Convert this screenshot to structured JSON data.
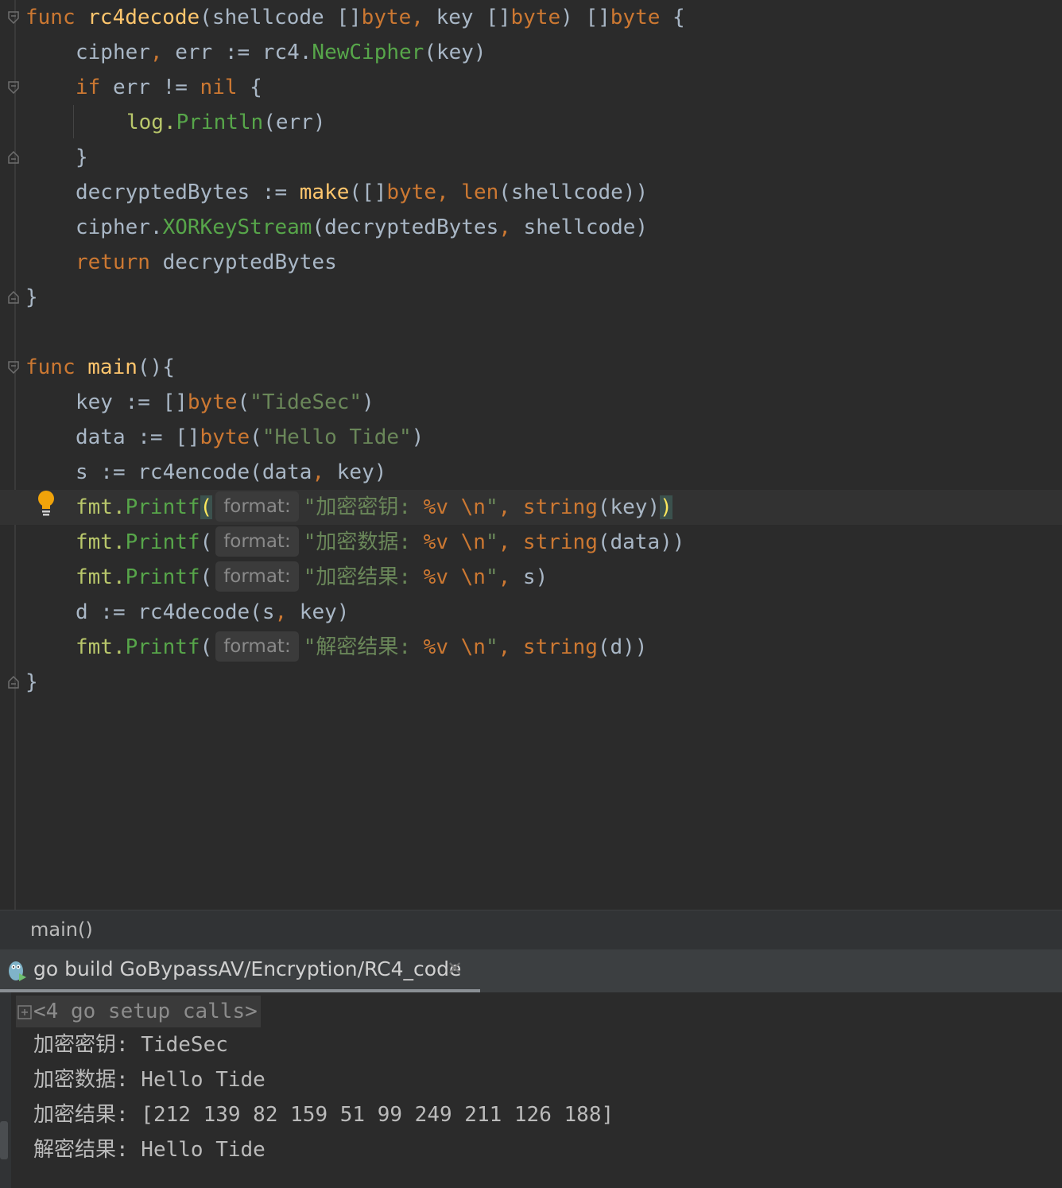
{
  "editor": {
    "lines": [
      [
        "func ",
        "rc4decode",
        "(shellcode []",
        "byte",
        ", ",
        "key []",
        "byte",
        ") []",
        "byte",
        " {"
      ],
      [
        "cipher",
        ", ",
        "err := rc4.",
        "NewCipher",
        "(key)"
      ],
      [
        "if",
        " err != ",
        "nil",
        " {"
      ],
      [
        "log.",
        "Println",
        "(err)"
      ],
      [
        "}"
      ],
      [
        "decryptedBytes := ",
        "make",
        "([]",
        "byte",
        ", ",
        "len",
        "(shellcode))"
      ],
      [
        "cipher.",
        "XORKeyStream",
        "(decryptedBytes",
        ", ",
        "shellcode)"
      ],
      [
        "return",
        " decryptedBytes"
      ],
      [
        "}"
      ],
      [
        "func ",
        "main",
        "(){"
      ],
      [
        "key := []",
        "byte",
        "(",
        "\"TideSec\"",
        ")"
      ],
      [
        "data := []",
        "byte",
        "(",
        "\"Hello Tide\"",
        ")"
      ],
      [
        "s := ",
        "rc4encode",
        "(data",
        ", ",
        "key)"
      ],
      [
        "fmt.",
        "Printf",
        "(",
        "\"加密密钥: ",
        "%v \\n",
        "\"",
        ", ",
        "string",
        "(key)",
        ")"
      ],
      [
        "fmt.",
        "Printf",
        "(",
        "\"加密数据: ",
        "%v \\n",
        "\"",
        ", ",
        "string",
        "(data))"
      ],
      [
        "fmt.",
        "Printf",
        "(",
        "\"加密结果: ",
        "%v \\n",
        "\"",
        ", ",
        "s)"
      ],
      [
        "d := ",
        "rc4decode",
        "(s",
        ", ",
        "key)"
      ],
      [
        "fmt.",
        "Printf",
        "(",
        "\"解密结果: ",
        "%v \\n",
        "\"",
        ", ",
        "string",
        "(d))"
      ],
      [
        "}"
      ]
    ],
    "param_hint": "format:"
  },
  "breadcrumb": {
    "label": "main()"
  },
  "run_tab": {
    "label": "go build GoBypassAV/Encryption/RC4_code",
    "close": "✕"
  },
  "console": {
    "setup_calls": "<4 go setup calls>",
    "output": [
      "加密密钥: TideSec",
      "加密数据: Hello Tide",
      "加密结果: [212 139 82 159 51 99 249 211 126 188]",
      "解密结果: Hello Tide"
    ]
  },
  "icons": [
    "fold-icon",
    "lightbulb-icon",
    "gopher-run-icon",
    "expand-icon",
    "close-icon"
  ],
  "colors": {
    "keyword": "#cc7832",
    "function": "#ffc66d",
    "method": "#57a64a",
    "string": "#6a8759",
    "text": "#a9b7c6",
    "background": "#2b2b2b"
  }
}
